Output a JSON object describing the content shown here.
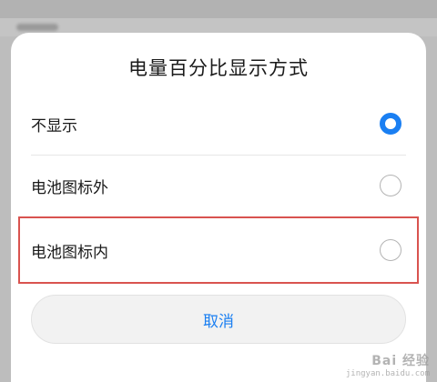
{
  "dialog": {
    "title": "电量百分比显示方式",
    "options": [
      {
        "label": "不显示",
        "selected": true
      },
      {
        "label": "电池图标外",
        "selected": false
      },
      {
        "label": "电池图标内",
        "selected": false
      }
    ],
    "cancel_label": "取消"
  },
  "watermark": {
    "main": "Bai 经验",
    "sub": "jingyan.baidu.com"
  },
  "colors": {
    "accent": "#1a7ff2",
    "highlight_border": "#d9534f"
  }
}
